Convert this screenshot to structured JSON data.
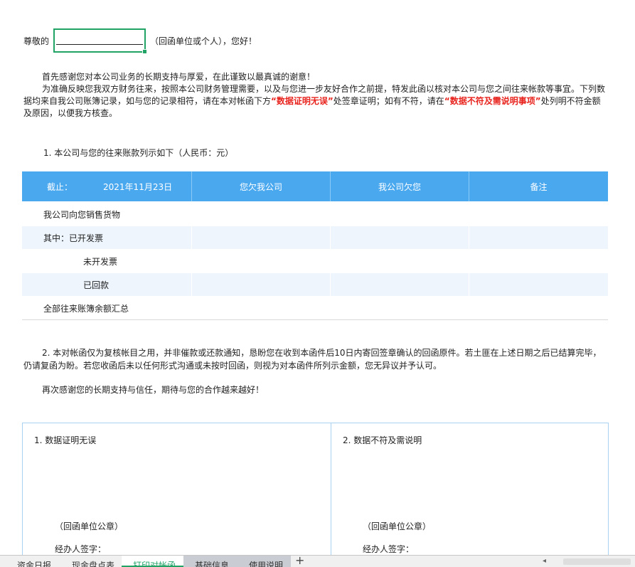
{
  "greeting": {
    "prefix": "尊敬的",
    "suffix": "（回函单位或个人），您好！"
  },
  "intro": {
    "line1": "首先感谢您对本公司业务的长期支持与厚爱，在此谨致以最真诚的谢意！",
    "line2_a": "为准确反映您我双方财务往来，按照本公司财务管理需要，以及与您进一步友好合作之前提，特发此函以核对本公司与您之间往来帐款等事宜。下列数据均来自我公司账簿记录，如与您的记录相符，请在本对帐函下方",
    "highlight1": "“数据证明无误”",
    "line2_b": "处签章证明；如有不符，请在",
    "highlight2": "“数据不符及需说明事项”",
    "line2_c": "处列明不符金额及原因，以便我方核查。"
  },
  "section1_title": "1.   本公司与您的往来账款列示如下（人民币：元）",
  "table": {
    "cutoff_label": "截止：",
    "cutoff_date": "2021年11月23日",
    "col2": "您欠我公司",
    "col3": "我公司欠您",
    "col4": "备注",
    "rows": [
      {
        "label": "我公司向您销售货物"
      },
      {
        "label": "其中：已开发票"
      },
      {
        "label": "未开发票"
      },
      {
        "label": "已回款"
      },
      {
        "label": "全部往来账簿余额汇总"
      }
    ]
  },
  "section2": "2.   本对帐函仅为复核帐目之用，并非催款或还款通知，恳盼您在收到本函件后10日内寄回签章确认的回函原件。若土匪在上述日期之后已结算完毕，仍请复函为盼。若您收函后未以任何形式沟通或未按时回函，则视为对本函件所列示金额，您无异议并予认可。",
  "thanks": "再次感谢您的长期支持与信任，期待与您的合作越来越好！",
  "sign": {
    "left_title": "1.   数据证明无误",
    "right_title": "2.   数据不符及需说明",
    "seal": "（回函单位公章）",
    "signer": "经办人签字："
  },
  "tabs": [
    {
      "label": "资金日报"
    },
    {
      "label": "现金盘点表"
    },
    {
      "label": "打印对帐函"
    },
    {
      "label": "基础信息"
    },
    {
      "label": "使用说明"
    }
  ],
  "add_sheet": "+",
  "colors": {
    "header_blue": "#4aa8ef",
    "row_shade": "#eef5fd",
    "accent_green": "#21a366",
    "highlight_red": "#e8231d"
  }
}
